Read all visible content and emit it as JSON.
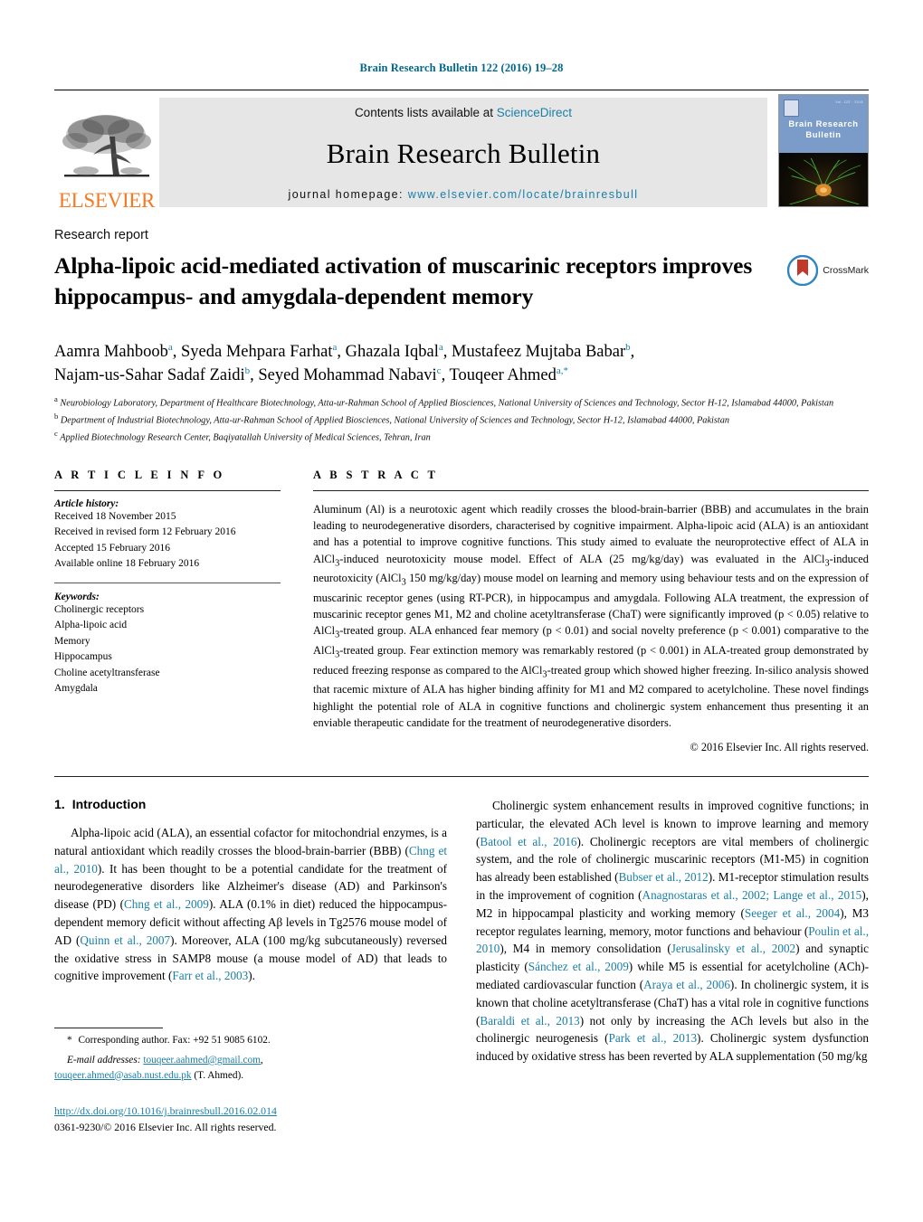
{
  "running_head": "Brain Research Bulletin 122 (2016) 19–28",
  "masthead": {
    "publisher_logo_text": "ELSEVIER",
    "contents_prefix": "Contents lists available at ",
    "contents_link": "ScienceDirect",
    "journal_name": "Brain Research Bulletin",
    "homepage_prefix": "journal homepage: ",
    "homepage_url": "www.elsevier.com/locate/brainresbull",
    "cover_title": "Brain Research\nBulletin",
    "cover_top_right": "Vol. 122 · 2016"
  },
  "article": {
    "type": "Research report",
    "title": "Alpha-lipoic acid-mediated activation of muscarinic receptors improves hippocampus- and amygdala-dependent memory",
    "crossmark_label": "CrossMark"
  },
  "authors": [
    {
      "name": "Aamra Mahboob",
      "sup": "a",
      "sep": ", "
    },
    {
      "name": "Syeda Mehpara Farhat",
      "sup": "a",
      "sep": ", "
    },
    {
      "name": "Ghazala Iqbal",
      "sup": "a",
      "sep": ", "
    },
    {
      "name": "Mustafeez Mujtaba Babar",
      "sup": "b",
      "sep": ", "
    },
    {
      "name": "Najam-us-Sahar Sadaf Zaidi",
      "sup": "b",
      "sep": ", "
    },
    {
      "name": "Seyed Mohammad Nabavi",
      "sup": "c",
      "sep": ", "
    },
    {
      "name": "Touqeer Ahmed",
      "sup": "a,",
      "star": "*",
      "sep": ""
    }
  ],
  "affiliations": [
    {
      "marker": "a",
      "text": "Neurobiology Laboratory, Department of Healthcare Biotechnology, Atta-ur-Rahman School of Applied Biosciences, National University of Sciences and Technology, Sector H-12, Islamabad 44000, Pakistan"
    },
    {
      "marker": "b",
      "text": "Department of Industrial Biotechnology, Atta-ur-Rahman School of Applied Biosciences, National University of Sciences and Technology, Sector H-12, Islamabad 44000, Pakistan"
    },
    {
      "marker": "c",
      "text": "Applied Biotechnology Research Center, Baqiyatallah University of Medical Sciences, Tehran, Iran"
    }
  ],
  "article_info": {
    "heading": "A R T I C L E    I N F O",
    "history_title": "Article history:",
    "history": [
      "Received 18 November 2015",
      "Received in revised form 12 February 2016",
      "Accepted 15 February 2016",
      "Available online 18 February 2016"
    ],
    "keywords_title": "Keywords:",
    "keywords": [
      "Cholinergic receptors",
      "Alpha-lipoic acid",
      "Memory",
      "Hippocampus",
      "Choline acetyltransferase",
      "Amygdala"
    ]
  },
  "abstract": {
    "heading": "A B S T R A C T",
    "text": "Aluminum (Al) is a neurotoxic agent which readily crosses the blood-brain-barrier (BBB) and accumulates in the brain leading to neurodegenerative disorders, characterised by cognitive impairment. Alpha-lipoic acid (ALA) is an antioxidant and has a potential to improve cognitive functions. This study aimed to evaluate the neuroprotective effect of ALA in AlCl3-induced neurotoxicity mouse model. Effect of ALA (25 mg/kg/day) was evaluated in the AlCl3-induced neurotoxicity (AlCl3 150 mg/kg/day) mouse model on learning and memory using behaviour tests and on the expression of muscarinic receptor genes (using RT-PCR), in hippocampus and amygdala. Following ALA treatment, the expression of muscarinic receptor genes M1, M2 and choline acetyltransferase (ChaT) were significantly improved (p < 0.05) relative to AlCl3-treated group. ALA enhanced fear memory (p < 0.01) and social novelty preference (p < 0.001) comparative to the AlCl3-treated group. Fear extinction memory was remarkably restored (p < 0.001) in ALA-treated group demonstrated by reduced freezing response as compared to the AlCl3-treated group which showed higher freezing. In-silico analysis showed that racemic mixture of ALA has higher binding affinity for M1 and M2 compared to acetylcholine. These novel findings highlight the potential role of ALA in cognitive functions and cholinergic system enhancement thus presenting it an enviable therapeutic candidate for the treatment of neurodegenerative disorders.",
    "copyright": "© 2016 Elsevier Inc. All rights reserved."
  },
  "introduction": {
    "number": "1.",
    "heading": "Introduction",
    "left_paragraph": "Alpha-lipoic acid (ALA), an essential cofactor for mitochondrial enzymes, is a natural antioxidant which readily crosses the blood-brain-barrier (BBB) (Chng et al., 2010). It has been thought to be a potential candidate for the treatment of neurodegenerative disorders like Alzheimer's disease (AD) and Parkinson's disease (PD) (Chng et al., 2009). ALA (0.1% in diet) reduced the hippocampus-dependent memory deficit without affecting Aβ levels in Tg2576 mouse model of AD (Quinn et al., 2007). Moreover, ALA (100 mg/kg subcutaneously) reversed the oxidative stress in SAMP8 mouse (a mouse model of AD) that leads to cognitive improvement (Farr et al., 2003).",
    "right_paragraph": "Cholinergic system enhancement results in improved cognitive functions; in particular, the elevated ACh level is known to improve learning and memory (Batool et al., 2016). Cholinergic receptors are vital members of cholinergic system, and the role of cholinergic muscarinic receptors (M1-M5) in cognition has already been established (Bubser et al., 2012). M1-receptor stimulation results in the improvement of cognition (Anagnostaras et al., 2002; Lange et al., 2015), M2 in hippocampal plasticity and working memory (Seeger et al., 2004), M3 receptor regulates learning, memory, motor functions and behaviour (Poulin et al., 2010), M4 in memory consolidation (Jerusalinsky et al., 2002) and synaptic plasticity (Sánchez et al., 2009) while M5 is essential for acetylcholine (ACh)-mediated cardiovascular function (Araya et al., 2006). In cholinergic system, it is known that choline acetyltransferase (ChaT) has a vital role in cognitive functions (Baraldi et al., 2013) not only by increasing the ACh levels but also in the cholinergic neurogenesis (Park et al., 2013). Cholinergic system dysfunction induced by oxidative stress has been reverted by ALA supplementation (50 mg/kg",
    "left_refs": [
      "Chng et al., 2010",
      "Chng et al., 2009",
      "Quinn et al., 2007",
      "Farr et al., 2003"
    ],
    "right_refs": [
      "Batool et al., 2016",
      "Bubser et al., 2012",
      "Anagnostaras et al., 2002; Lange et al., 2015",
      "Seeger et al., 2004",
      "Poulin et al., 2010",
      "Jerusalinsky et al., 2002",
      "Sánchez et al., 2009",
      "Araya et al., 2006",
      "Baraldi et al., 2013",
      "Park et al., 2013"
    ]
  },
  "footnotes": {
    "corresponding_marker": "*",
    "corresponding_text": "Corresponding author. Fax: +92 51 9085 6102.",
    "email_label": "E-mail addresses:",
    "email_1": "touqeer.aahmed@gmail.com",
    "email_sep": ",",
    "email_2": "touqeer.ahmed@asab.nust.edu.pk",
    "email_suffix": "(T. Ahmed).",
    "doi": "http://dx.doi.org/10.1016/j.brainresbull.2016.02.014",
    "issn": "0361-9230/© 2016 Elsevier Inc. All rights reserved."
  },
  "colors": {
    "link": "#1a7fa8",
    "running_head": "#00688c",
    "elsevier_orange": "#F47920",
    "banner_bg": "#e6e6e6",
    "cover_blue": "#7b9cc9"
  }
}
